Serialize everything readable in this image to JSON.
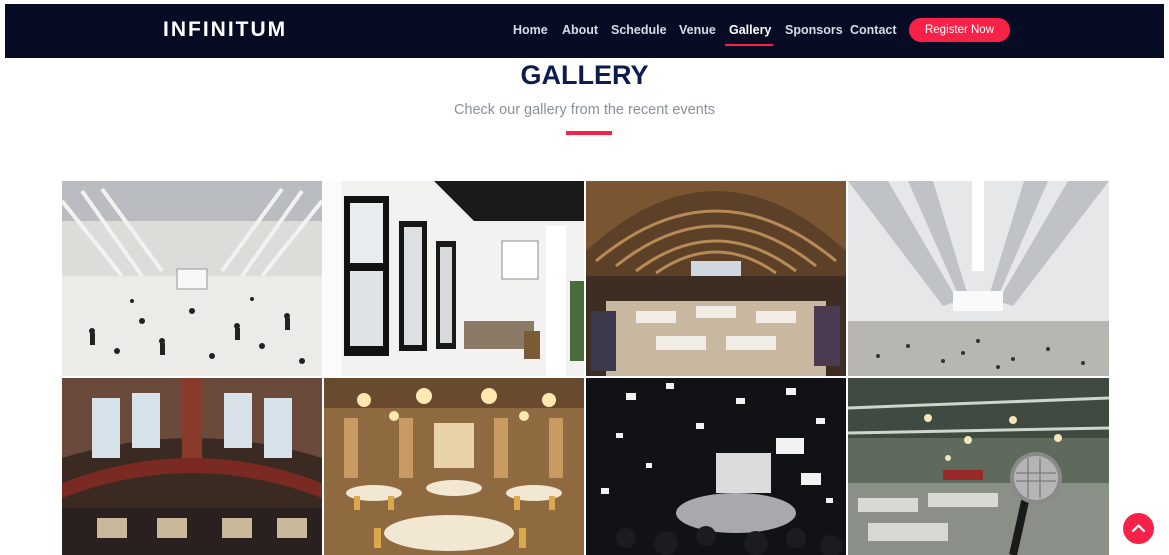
{
  "brand": "INFINITUM",
  "nav": {
    "items": [
      {
        "label": "Home"
      },
      {
        "label": "About"
      },
      {
        "label": "Schedule"
      },
      {
        "label": "Venue"
      },
      {
        "label": "Gallery",
        "active": true
      },
      {
        "label": "Sponsors"
      },
      {
        "label": "Contact"
      }
    ],
    "register_label": "Register Now"
  },
  "gallery": {
    "title": "GALLERY",
    "subtitle": "Check our gallery from the recent events"
  },
  "colors": {
    "navbar": "#070c24",
    "accent": "#f82249",
    "title": "#0e1b4d",
    "subtitle": "#8b8f9b"
  },
  "icons": {
    "scroll_top": "chevron-up-icon"
  }
}
